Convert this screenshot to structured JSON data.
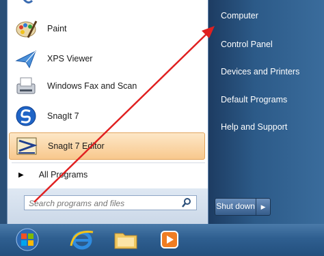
{
  "programs": [
    {
      "label": "Paint",
      "icon": "paint-icon"
    },
    {
      "label": "XPS Viewer",
      "icon": "xps-viewer-icon"
    },
    {
      "label": "Windows Fax and Scan",
      "icon": "fax-scan-icon"
    },
    {
      "label": "SnagIt 7",
      "icon": "snagit-icon"
    },
    {
      "label": "SnagIt 7 Editor",
      "icon": "snagit-editor-icon"
    }
  ],
  "all_programs": "All Programs",
  "search": {
    "placeholder": "Search programs and files"
  },
  "right_items": [
    "Computer",
    "Control Panel",
    "Devices and Printers",
    "Default Programs",
    "Help and Support"
  ],
  "shutdown": {
    "label": "Shut down"
  },
  "taskbar": [
    "start-orb-icon",
    "internet-explorer-icon",
    "file-explorer-icon",
    "media-player-icon"
  ],
  "colors": {
    "highlight": "#f8c88d",
    "annotation": "#e02020"
  }
}
